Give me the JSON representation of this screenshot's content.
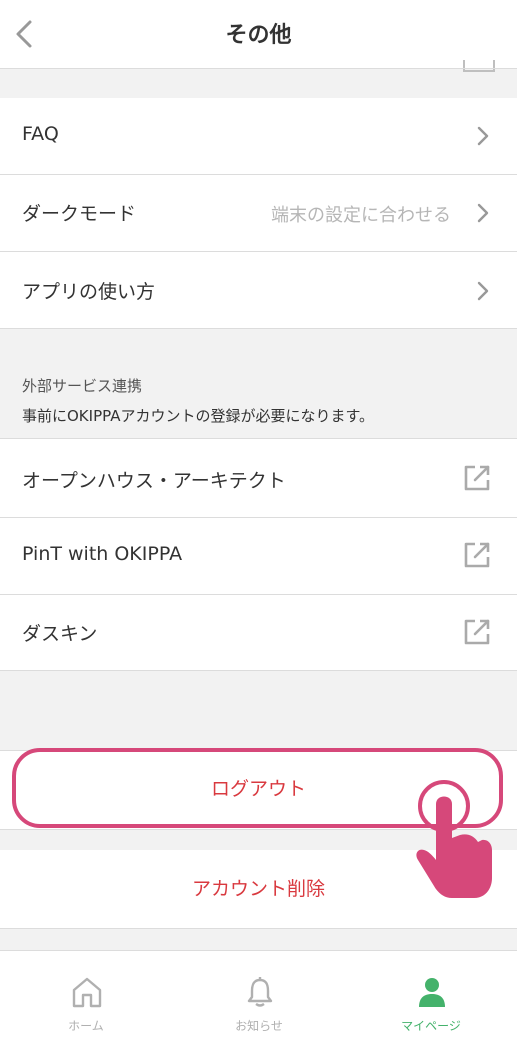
{
  "header": {
    "title": "その他"
  },
  "menu": [
    {
      "label": "FAQ",
      "value": ""
    },
    {
      "label": "ダークモード",
      "value": "端末の設定に合わせる"
    },
    {
      "label": "アプリの使い方",
      "value": ""
    }
  ],
  "external_section": {
    "caption": "外部サービス連携",
    "note": "事前にOKIPPAアカウントの登録が必要になります。",
    "items": [
      {
        "label": "オープンハウス・アーキテクト"
      },
      {
        "label": "PinT with OKIPPA"
      },
      {
        "label": "ダスキン"
      }
    ]
  },
  "actions": {
    "logout": "ログアウト",
    "delete_account": "アカウント削除"
  },
  "tabbar": {
    "items": [
      {
        "label": "ホーム",
        "icon": "home-icon"
      },
      {
        "label": "お知らせ",
        "icon": "bell-icon"
      },
      {
        "label": "マイページ",
        "icon": "person-icon",
        "active": true
      }
    ]
  },
  "colors": {
    "accent_red": "#d9393f",
    "highlight_pink": "#d6487a",
    "active_green": "#44b26b"
  }
}
